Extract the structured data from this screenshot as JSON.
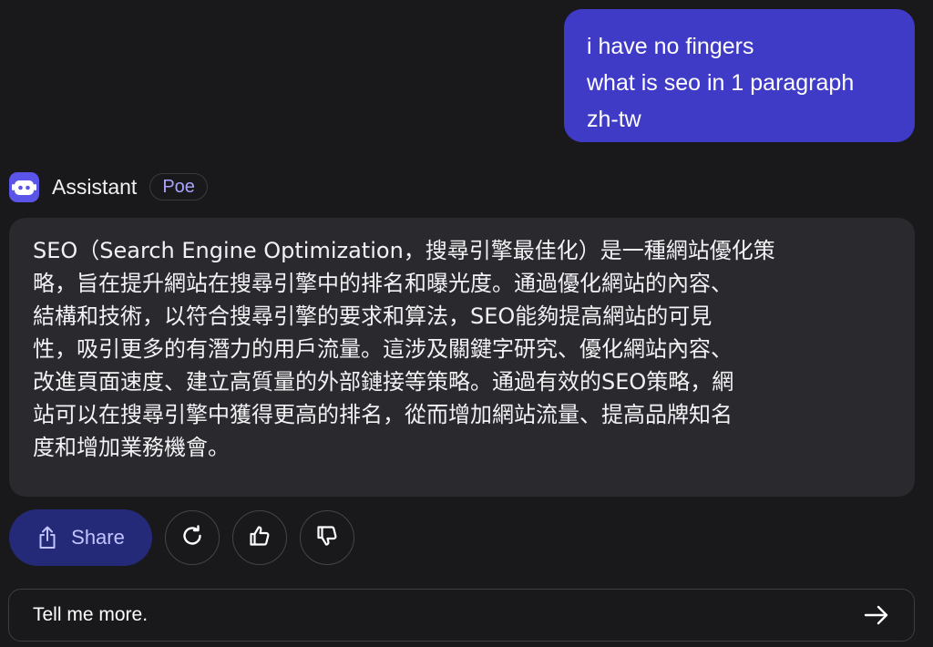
{
  "user_message": {
    "lines": [
      "i have no fingers",
      "what is seo in 1 paragraph",
      "zh-tw"
    ]
  },
  "bot": {
    "name": "Assistant",
    "badge": "Poe",
    "avatar_icon": "robot-icon",
    "message_lines": [
      "SEO（Search Engine Optimization，搜尋引擎最佳化）是一種網站優化策",
      "略，旨在提升網站在搜尋引擎中的排名和曝光度。通過優化網站的內容、",
      "結構和技術，以符合搜尋引擎的要求和算法，SEO能夠提高網站的可見",
      "性，吸引更多的有潛力的用戶流量。這涉及關鍵字研究、優化網站內容、",
      "改進頁面速度、建立高質量的外部鏈接等策略。通過有效的SEO策略，網",
      "站可以在搜尋引擎中獲得更高的排名，從而增加網站流量、提高品牌知名",
      "度和增加業務機會。"
    ]
  },
  "actions": {
    "share_label": "Share",
    "share_icon": "share-icon",
    "retry_icon": "retry-icon",
    "thumbs_up_icon": "thumbs-up-icon",
    "thumbs_down_icon": "thumbs-down-icon"
  },
  "composer": {
    "value": "Tell me more.",
    "send_icon": "arrow-right-icon"
  },
  "colors": {
    "background": "#19181b",
    "user_bubble": "#3f3bc7",
    "bot_bubble": "#2a292e",
    "share_button": "#242a78",
    "accent": "#5b54e8"
  }
}
